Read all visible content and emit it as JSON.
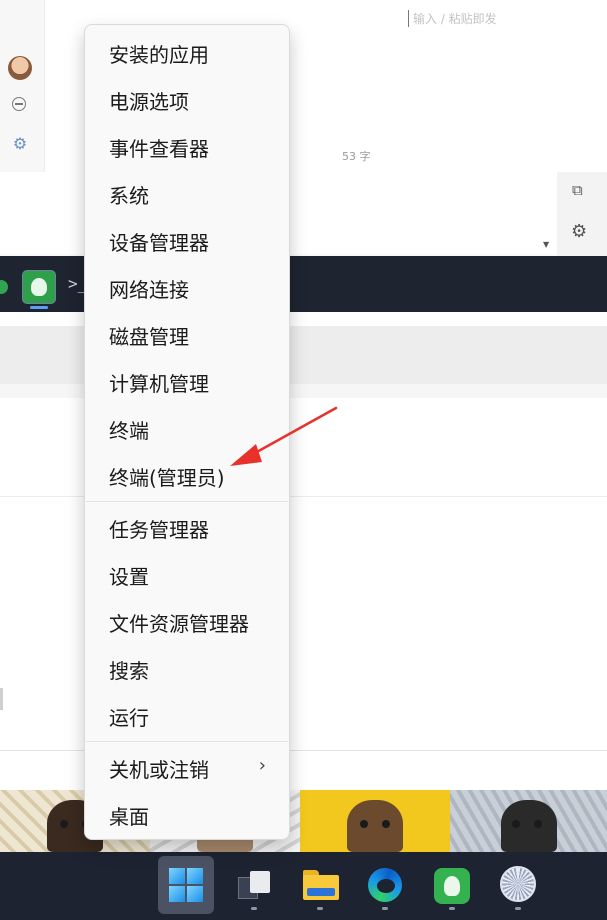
{
  "background_window": {
    "compose_placeholder": "输入 / 粘贴即发",
    "char_count": "53 字"
  },
  "context_menu": {
    "items": [
      {
        "label": "安装的应用"
      },
      {
        "label": "电源选项"
      },
      {
        "label": "事件查看器"
      },
      {
        "label": "系统"
      },
      {
        "label": "设备管理器"
      },
      {
        "label": "网络连接"
      },
      {
        "label": "磁盘管理"
      },
      {
        "label": "计算机管理"
      },
      {
        "label": "终端"
      },
      {
        "label": "终端(管理员)"
      },
      {
        "label": "任务管理器"
      },
      {
        "label": "设置"
      },
      {
        "label": "文件资源管理器"
      },
      {
        "label": "搜索"
      },
      {
        "label": "运行"
      },
      {
        "label": "关机或注销",
        "submenu": true
      },
      {
        "label": "桌面"
      }
    ]
  },
  "annotation": {
    "color": "#e8312a",
    "points_to": "终端(管理员)"
  },
  "taskbar": {
    "icons": [
      "start-icon",
      "task-view-icon",
      "file-explorer-icon",
      "edge-icon",
      "green-app-icon",
      "wheel-app-icon"
    ],
    "accent": "#1d2330"
  }
}
